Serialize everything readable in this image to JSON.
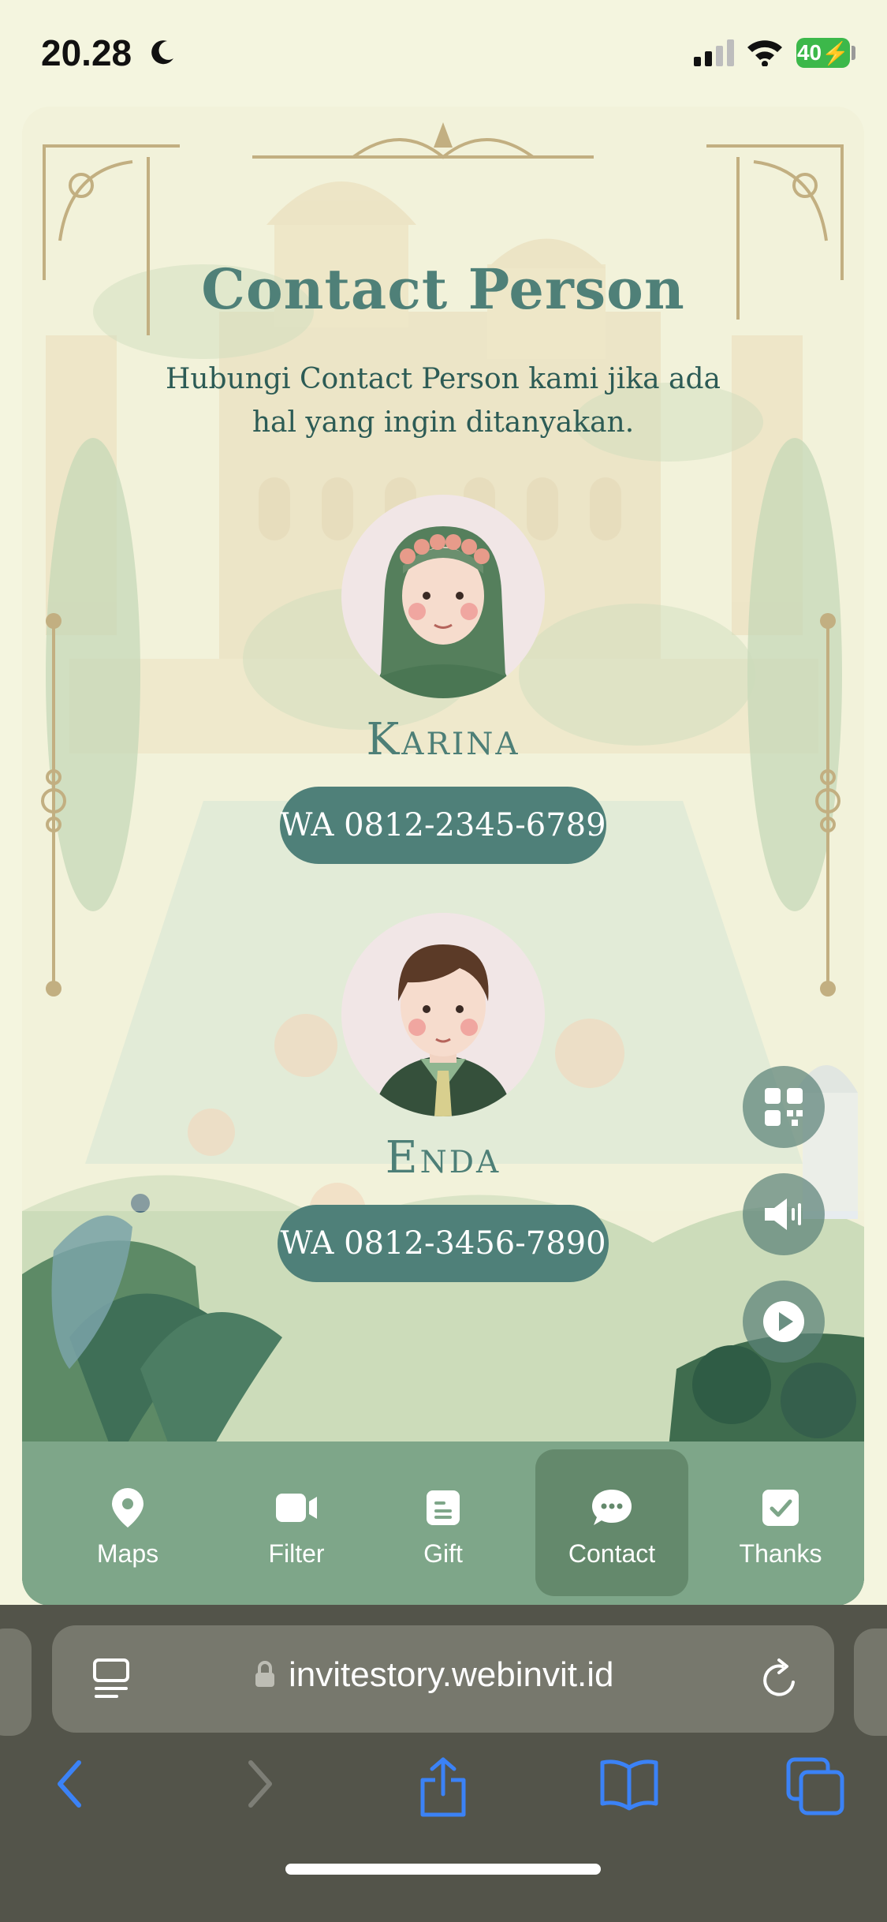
{
  "status_bar": {
    "time": "20.28",
    "battery": "40",
    "icons": [
      "moon-icon",
      "signal-icon",
      "wifi-icon",
      "battery-charging-icon"
    ]
  },
  "section": {
    "title": "Contact Person",
    "subtitle": "Hubungi Contact Person kami jika ada hal yang ingin ditanyakan."
  },
  "contacts": [
    {
      "name": "Karina",
      "button": "WA 0812-2345-6789",
      "avatar": "female-avatar-hijab"
    },
    {
      "name": "Enda",
      "button": "WA 0812-3456-7890",
      "avatar": "male-avatar-suit"
    }
  ],
  "floating_buttons": [
    "qr-code-icon",
    "speaker-icon",
    "play-icon"
  ],
  "nav": {
    "items": [
      {
        "label": "Maps",
        "icon": "map-pin-icon"
      },
      {
        "label": "Filter",
        "icon": "video-camera-icon"
      },
      {
        "label": "Gift",
        "icon": "gift-document-icon"
      },
      {
        "label": "Contact",
        "icon": "chat-bubble-icon"
      },
      {
        "label": "Thanks",
        "icon": "checkmark-icon"
      }
    ],
    "active": "Contact"
  },
  "browser": {
    "url": "invitestory.webinvit.id",
    "toolbar_icons": [
      "back-icon",
      "forward-icon",
      "share-icon",
      "bookmarks-icon",
      "tabs-icon"
    ]
  },
  "colors": {
    "accent": "#4f8079",
    "title": "#4f8078",
    "nav_bg": "#7ea689",
    "nav_active": "#64896c",
    "page_bg": "#f4f5df",
    "gold": "#a88a50",
    "ios_blue": "#3b82f6"
  }
}
